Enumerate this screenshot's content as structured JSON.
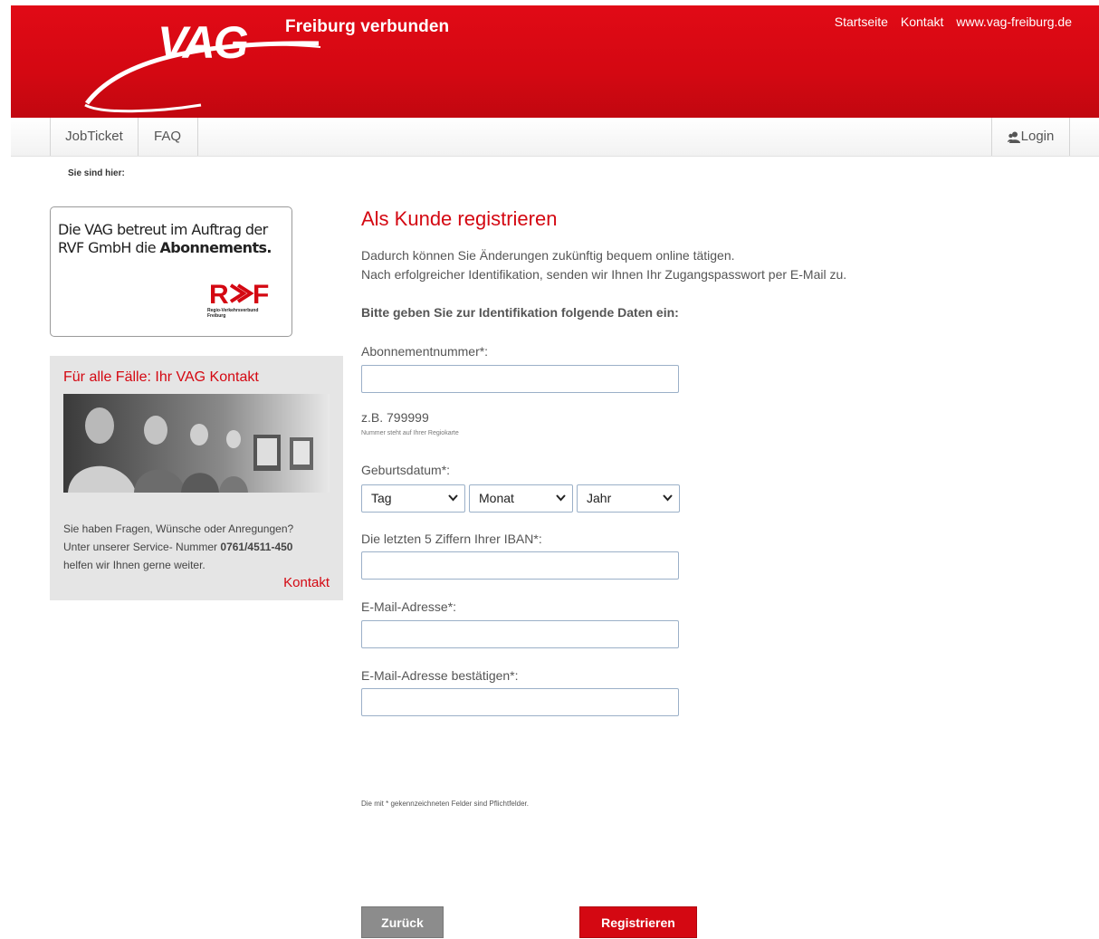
{
  "brand": {
    "logo_text": "VAG",
    "tagline": "Freiburg verbunden",
    "primary_color": "#d40812"
  },
  "top_links": [
    "Startseite",
    "Kontakt",
    "www.vag-freiburg.de"
  ],
  "nav": {
    "items": [
      "JobTicket",
      "FAQ"
    ],
    "login": "Login",
    "login_icon": "user-icon"
  },
  "breadcrumb": "Sie sind hier:",
  "sidebar": {
    "rvf_box": {
      "text_line1": "Die VAG betreut im Auftrag der",
      "text_line2_prefix": "RVF GmbH die ",
      "text_line2_bold": "Abonnements.",
      "logo_text": "RVF",
      "logo_subtext": [
        "Regio-Verkehrsverbund",
        "Freiburg"
      ]
    },
    "contact": {
      "title": "Für alle Fälle: Ihr VAG Kontakt",
      "image_alt": "call-center-agents-image",
      "line1": "Sie haben Fragen, Wünsche oder Anregungen?",
      "line2_prefix": "Unter unserer Service- Nummer ",
      "phone": "0761/4511-450",
      "line3": "helfen wir Ihnen gerne weiter.",
      "link": "Kontakt"
    }
  },
  "main": {
    "title": "Als Kunde registrieren",
    "intro_line1": "Dadurch können Sie Änderungen zukünftig bequem online tätigen.",
    "intro_line2": "Nach erfolgreicher Identifikation, senden wir Ihnen Ihr Zugangspasswort per E-Mail zu.",
    "instruction": "Bitte geben Sie zur Identifikation folgende Daten ein:",
    "fields": {
      "abo_label": "Abonnementnummer*:",
      "abo_value": "",
      "abo_hint": "z.B. 799999",
      "abo_hint_small": "Nummer steht auf Ihrer Regiokarte",
      "birth_label": "Geburtsdatum*:",
      "day": "Tag",
      "month": "Monat",
      "year": "Jahr",
      "iban_label": "Die letzten 5 Ziffern Ihrer IBAN*:",
      "iban_value": "",
      "email_label": "E-Mail-Adresse*:",
      "email_value": "",
      "email_confirm_label": "E-Mail-Adresse bestätigen*:",
      "email_confirm_value": ""
    },
    "required_note": "Die mit * gekennzeichneten Felder sind Pflichtfelder.",
    "buttons": {
      "back": "Zurück",
      "register": "Registrieren"
    }
  }
}
